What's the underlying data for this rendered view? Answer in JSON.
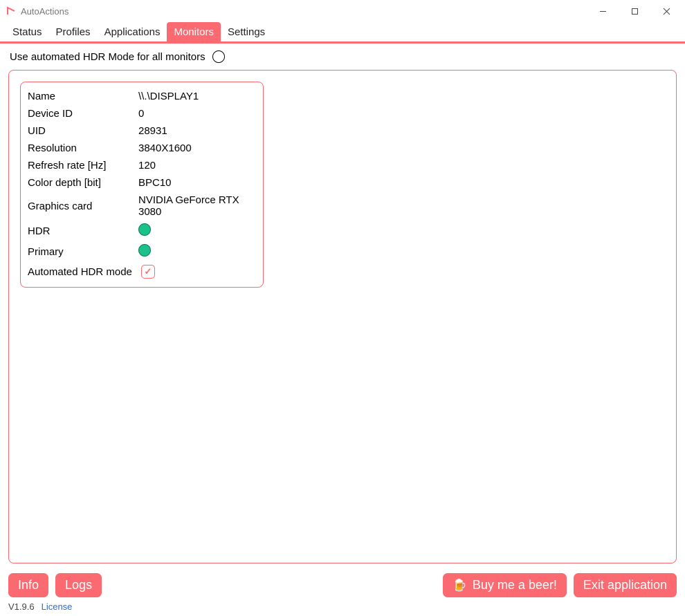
{
  "window": {
    "title": "AutoActions"
  },
  "tabs": [
    "Status",
    "Profiles",
    "Applications",
    "Monitors",
    "Settings"
  ],
  "active_tab": "Monitors",
  "option": {
    "label": "Use automated HDR Mode for all monitors"
  },
  "monitor": {
    "rows": [
      {
        "label": "Name",
        "value": "\\\\.\\DISPLAY1"
      },
      {
        "label": "Device ID",
        "value": "0"
      },
      {
        "label": "UID",
        "value": "28931"
      },
      {
        "label": "Resolution",
        "value": "3840X1600"
      },
      {
        "label": "Refresh rate [Hz]",
        "value": "120"
      },
      {
        "label": "Color depth [bit]",
        "value": "BPC10"
      },
      {
        "label": "Graphics card",
        "value": "NVIDIA GeForce RTX 3080"
      }
    ],
    "hdr_label": "HDR",
    "primary_label": "Primary",
    "auto_hdr_label": "Automated HDR mode"
  },
  "footer": {
    "info": "Info",
    "logs": "Logs",
    "beer": "Buy me a beer!",
    "exit": "Exit application"
  },
  "status": {
    "version": "V1.9.6",
    "license": "License"
  }
}
